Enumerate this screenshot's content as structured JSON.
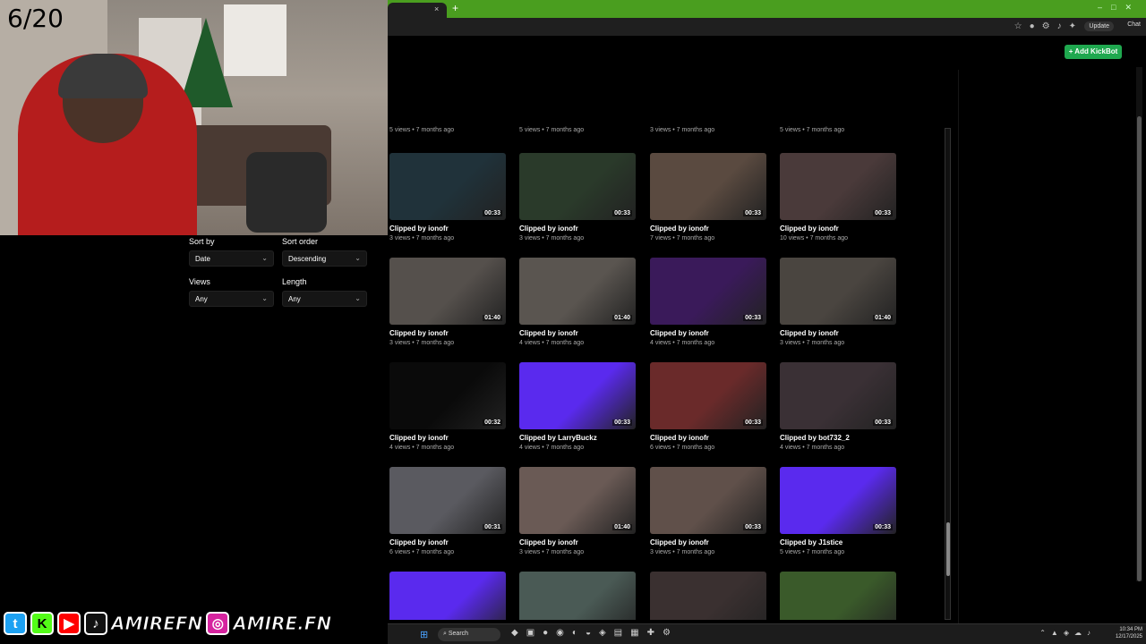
{
  "overlay": {
    "counter": "6/20"
  },
  "browser": {
    "tab_close": "×",
    "new_tab": "+",
    "update_label": "Update",
    "chat_label": "Chat",
    "kickbot_label": "+ Add KickBot"
  },
  "filters": {
    "sort_by": {
      "label": "Sort by",
      "value": "Date"
    },
    "sort_order": {
      "label": "Sort order",
      "value": "Descending"
    },
    "views": {
      "label": "Views",
      "value": "Any"
    },
    "length": {
      "label": "Length",
      "value": "Any"
    }
  },
  "top_meta": [
    "5 views • 7 months ago",
    "5 views • 7 months ago",
    "3 views • 7 months ago",
    "5 views • 7 months ago"
  ],
  "clips": [
    {
      "title": "Clipped by ionofr",
      "meta": "3 views • 7 months ago",
      "duration": "00:33",
      "color": "#20323a"
    },
    {
      "title": "Clipped by ionofr",
      "meta": "3 views • 7 months ago",
      "duration": "00:33",
      "color": "#2a3a2a"
    },
    {
      "title": "Clipped by ionofr",
      "meta": "7 views • 7 months ago",
      "duration": "00:33",
      "color": "#5a4a40"
    },
    {
      "title": "Clipped by ionofr",
      "meta": "10 views • 7 months ago",
      "duration": "00:33",
      "color": "#4a3a3a"
    },
    {
      "title": "Clipped by ionofr",
      "meta": "3 views • 7 months ago",
      "duration": "01:40",
      "color": "#55504c"
    },
    {
      "title": "Clipped by ionofr",
      "meta": "4 views • 7 months ago",
      "duration": "01:40",
      "color": "#5a5550"
    },
    {
      "title": "Clipped by ionofr",
      "meta": "4 views • 7 months ago",
      "duration": "00:33",
      "color": "#3a1a5a"
    },
    {
      "title": "Clipped by ionofr",
      "meta": "3 views • 7 months ago",
      "duration": "01:40",
      "color": "#4a4540"
    },
    {
      "title": "Clipped by ionofr",
      "meta": "4 views • 7 months ago",
      "duration": "00:32",
      "color": "#0a0a0a"
    },
    {
      "title": "Clipped by LarryBuckz",
      "meta": "4 views • 7 months ago",
      "duration": "00:33",
      "color": "#5a2aee"
    },
    {
      "title": "Clipped by ionofr",
      "meta": "6 views • 7 months ago",
      "duration": "00:33",
      "color": "#6a2a2a"
    },
    {
      "title": "Clipped by bot732_2",
      "meta": "4 views • 7 months ago",
      "duration": "00:33",
      "color": "#3a3035"
    },
    {
      "title": "Clipped by ionofr",
      "meta": "6 views • 7 months ago",
      "duration": "00:31",
      "color": "#5a5a60"
    },
    {
      "title": "Clipped by ionofr",
      "meta": "3 views • 7 months ago",
      "duration": "01:40",
      "color": "#6a5a55"
    },
    {
      "title": "Clipped by ionofr",
      "meta": "3 views • 7 months ago",
      "duration": "00:33",
      "color": "#60504a"
    },
    {
      "title": "Clipped by J1stice",
      "meta": "5 views • 7 months ago",
      "duration": "00:33",
      "color": "#5a2aee"
    }
  ],
  "partial_clips": [
    {
      "color": "#5a2aee"
    },
    {
      "color": "#4a5a55"
    },
    {
      "color": "#3a3030"
    },
    {
      "color": "#3a5a2a"
    }
  ],
  "social": {
    "twitter": "t",
    "kick": "K",
    "youtube": "▶",
    "tiktok": "♪",
    "handle1": "AMIREFN",
    "instagram": "◎",
    "handle2": "AMIRE.FN"
  },
  "taskbar": {
    "search": "Search",
    "time": "10:34 PM",
    "date": "12/17/2025"
  }
}
